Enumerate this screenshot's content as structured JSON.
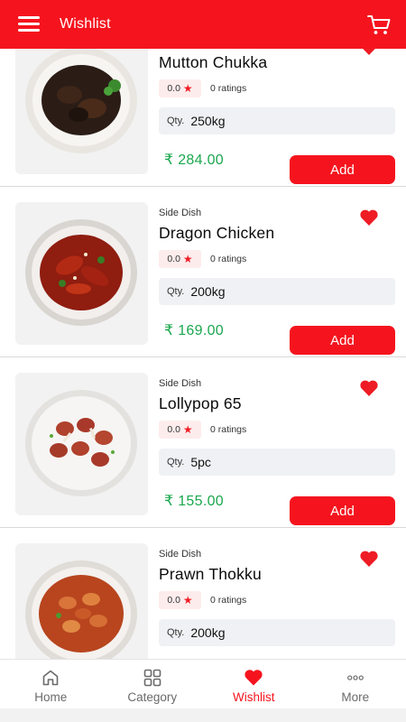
{
  "header": {
    "title": "Wishlist",
    "menu_icon": "hamburger-menu-icon",
    "cart_icon": "cart-icon"
  },
  "colors": {
    "brand": "#f5141e",
    "price": "#1aa74e",
    "chip_bg": "#fdecec",
    "qty_bg": "#f0f1f4"
  },
  "items": [
    {
      "category": "",
      "name": "Mutton Chukka",
      "rating": "0.0",
      "ratings_text": "0 ratings",
      "qty_label": "Qty.",
      "qty": "250kg",
      "price": "₹ 284.00",
      "add_label": "Add"
    },
    {
      "category": "Side Dish",
      "name": "Dragon Chicken",
      "rating": "0.0",
      "ratings_text": "0 ratings",
      "qty_label": "Qty.",
      "qty": "200kg",
      "price": "₹ 169.00",
      "add_label": "Add"
    },
    {
      "category": "Side Dish",
      "name": "Lollypop 65",
      "rating": "0.0",
      "ratings_text": "0 ratings",
      "qty_label": "Qty.",
      "qty": "5pc",
      "price": "₹ 155.00",
      "add_label": "Add"
    },
    {
      "category": "Side Dish",
      "name": "Prawn Thokku",
      "rating": "0.0",
      "ratings_text": "0 ratings",
      "qty_label": "Qty.",
      "qty": "200kg",
      "price": "",
      "add_label": ""
    }
  ],
  "nav": [
    {
      "label": "Home",
      "icon": "home-icon",
      "active": false
    },
    {
      "label": "Category",
      "icon": "grid-icon",
      "active": false
    },
    {
      "label": "Wishlist",
      "icon": "heart-icon",
      "active": true
    },
    {
      "label": "More",
      "icon": "more-dots-icon",
      "active": false
    }
  ]
}
